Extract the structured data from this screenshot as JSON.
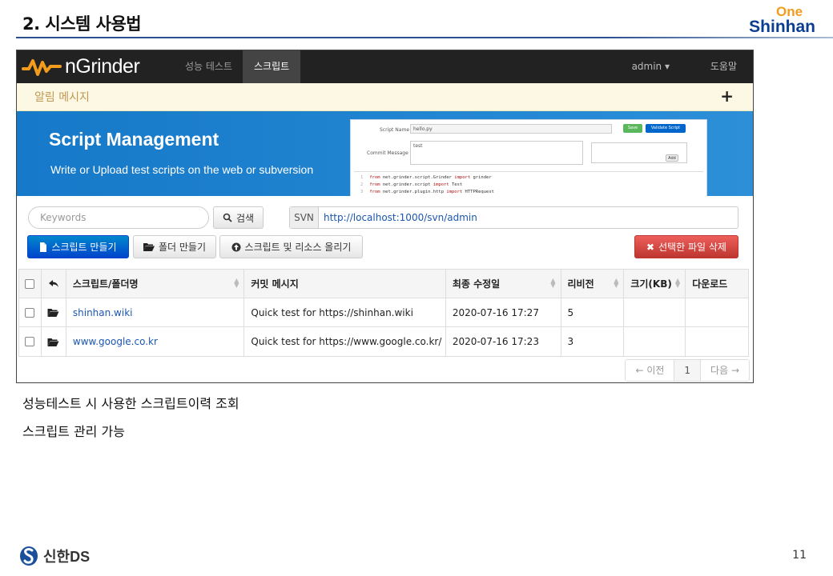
{
  "slide": {
    "title": "2. 시스템 사용법",
    "brand_top": "One",
    "brand_name": "Shinhan",
    "notes": [
      "성능테스트 시 사용한 스크립트이력 조회",
      "스크립트 관리 가능"
    ],
    "footer_brand": "신한DS",
    "page_number": "11"
  },
  "app": {
    "logo_text": "nGrinder",
    "nav": {
      "items": [
        {
          "label": "성능 테스트",
          "active": false
        },
        {
          "label": "스크립트",
          "active": true
        }
      ],
      "user_menu": "admin ▾",
      "help": "도움말"
    },
    "alert": {
      "text": "알림 메시지",
      "action": "+"
    },
    "banner": {
      "title": "Script Management",
      "subtitle": "Write or Upload test scripts on the web or subversion",
      "preview": {
        "script_name_label": "Script Name",
        "script_name_value": "hello.py",
        "commit_label": "Commit Message",
        "commit_value": "test",
        "save_label": "Save",
        "validate_label": "Validate Script",
        "add_label": "Add",
        "code_lines": [
          {
            "num": "1",
            "pre": "from ",
            "mid": "net.grinder.script.Grinder ",
            "kw": "import",
            "post": " grinder"
          },
          {
            "num": "2",
            "pre": "from ",
            "mid": "net.grinder.script ",
            "kw": "import",
            "post": " Test"
          },
          {
            "num": "3",
            "pre": "from ",
            "mid": "net.grinder.plugin.http ",
            "kw": "import",
            "post": " HTTPRequest"
          }
        ]
      }
    },
    "search": {
      "placeholder": "Keywords",
      "button_label": "검색"
    },
    "svn": {
      "tag": "SVN",
      "url": "http://localhost:1000/svn/admin"
    },
    "actions": {
      "create_script": "스크립트 만들기",
      "create_folder": "폴더 만들기",
      "upload": "스크립트 및 리소스 올리기",
      "delete": "선택한 파일 삭제"
    },
    "table": {
      "headers": [
        "스크립트/폴더명",
        "커밋 메시지",
        "최종 수정일",
        "리비전",
        "크기(KB)",
        "다운로드"
      ],
      "rows": [
        {
          "name": "shinhan.wiki",
          "message": "Quick test for https://shinhan.wiki",
          "date": "2020-07-16 17:27",
          "revision": "5",
          "size": "",
          "download": ""
        },
        {
          "name": "www.google.co.kr",
          "message": "Quick test for https://www.google.co.kr/",
          "date": "2020-07-16 17:23",
          "revision": "3",
          "size": "",
          "download": ""
        }
      ]
    },
    "pagination": {
      "prev": "← 이전",
      "current": "1",
      "next": "다음 →"
    }
  },
  "colors": {
    "brand_orange": "#f29b1d",
    "brand_blue": "#0b3d91",
    "banner_blue": "#1679c9",
    "primary": "#0044cc",
    "danger": "#bd362f"
  }
}
